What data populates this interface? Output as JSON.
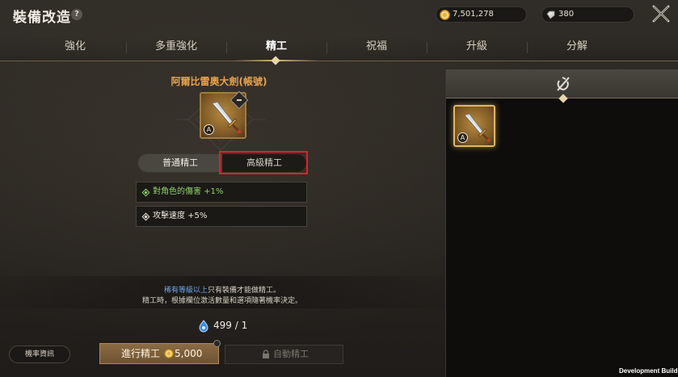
{
  "header": {
    "title": "裝備改造",
    "help_label": "?",
    "gold_amount": "7,501,278",
    "diamond_amount": "380"
  },
  "tabs": [
    {
      "label": "強化",
      "active": false
    },
    {
      "label": "多重強化",
      "active": false
    },
    {
      "label": "精工",
      "active": true
    },
    {
      "label": "祝福",
      "active": false
    },
    {
      "label": "升級",
      "active": false
    },
    {
      "label": "分解",
      "active": false
    }
  ],
  "item": {
    "name": "阿爾比雷奧大劍(帳號)",
    "grade": "A"
  },
  "refine_type": {
    "normal_label": "普通精工",
    "advanced_label": "高級精工",
    "selected": "normal"
  },
  "stats": [
    {
      "text": "對角色的傷害 +1%",
      "color": "#8ed26a"
    },
    {
      "text": "攻擊速度 +5%",
      "color": "#ece6da"
    }
  ],
  "info": {
    "line1_highlight": "稀有等級以上",
    "line1_rest": "只有裝備才能做精工。",
    "line2": "精工時，根據欄位激活數量和選項隨著機率決定。"
  },
  "cost": {
    "material": "499 / 1"
  },
  "buttons": {
    "rate_info": "機率資訊",
    "refine": "進行精工",
    "refine_cost": "5,000",
    "auto_refine": "自動精工"
  },
  "right_panel": {
    "items": [
      {
        "grade": "A",
        "selected": true
      }
    ]
  },
  "footer": {
    "dev_build": "Development Build"
  },
  "colors": {
    "accent_gold": "#e6a24a",
    "highlight_red": "#e0202a",
    "stat_green": "#8ed26a",
    "info_blue": "#6fa5ec"
  }
}
